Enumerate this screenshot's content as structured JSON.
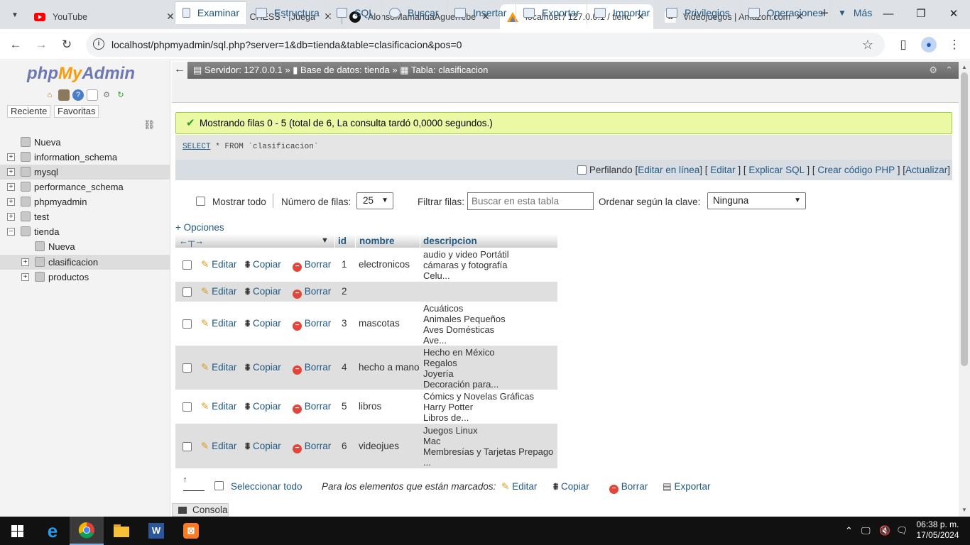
{
  "browser": {
    "tabs": [
      {
        "title": "YouTube",
        "icon": "youtube-icon"
      },
      {
        "title": "MASTER CHESS - ¡Juega Gr",
        "icon": "chess-icon"
      },
      {
        "title": "AlonsoMamahuaAguerrebe",
        "icon": "github-icon"
      },
      {
        "title": "localhost / 127.0.0.1 / tienda",
        "icon": "phpmyadmin-icon",
        "active": true
      },
      {
        "title": "Videojuegos | Amazon.com",
        "icon": "amazon-icon"
      }
    ],
    "url": "localhost/phpmyadmin/sql.php?server=1&db=tienda&table=clasificacion&pos=0"
  },
  "nav": {
    "logo_php": "php",
    "logo_my": "My",
    "logo_admin": "Admin",
    "tabs": [
      "Reciente",
      "Favoritas"
    ],
    "tree": [
      {
        "label": "Nueva",
        "level": 0,
        "expander": ""
      },
      {
        "label": "information_schema",
        "level": 0,
        "expander": "+"
      },
      {
        "label": "mysql",
        "level": 0,
        "expander": "+",
        "highlight": true
      },
      {
        "label": "performance_schema",
        "level": 0,
        "expander": "+"
      },
      {
        "label": "phpmyadmin",
        "level": 0,
        "expander": "+"
      },
      {
        "label": "test",
        "level": 0,
        "expander": "+"
      },
      {
        "label": "tienda",
        "level": 0,
        "expander": "−"
      },
      {
        "label": "Nueva",
        "level": 1,
        "expander": ""
      },
      {
        "label": "clasificacion",
        "level": 1,
        "expander": "+",
        "highlight": true
      },
      {
        "label": "productos",
        "level": 1,
        "expander": "+"
      }
    ]
  },
  "breadcrumb": {
    "server": "Servidor: 127.0.0.1",
    "database": "Base de datos: tienda",
    "table": "Tabla: clasificacion"
  },
  "main_tabs": [
    "Examinar",
    "Estructura",
    "SQL",
    "Buscar",
    "Insertar",
    "Exportar",
    "Importar",
    "Privilegios",
    "Operaciones",
    "Más"
  ],
  "success_message": "Mostrando filas 0 - 5 (total de 6, La consulta tardó 0,0000 segundos.)",
  "sql": {
    "select": "SELECT",
    "rest": " * FROM `clasificacion`"
  },
  "profiling": {
    "label": "Perfilando",
    "links": [
      "Editar en línea",
      "Editar",
      "Explicar SQL",
      "Crear código PHP",
      "Actualizar"
    ]
  },
  "filters": {
    "show_all": "Mostrar todo",
    "rows_label": "Número de filas:",
    "rows_value": "25",
    "filter_label": "Filtrar filas:",
    "filter_placeholder": "Buscar en esta tabla",
    "order_label": "Ordenar según la clave:",
    "order_value": "Ninguna"
  },
  "options_link": "+ Opciones",
  "table": {
    "columns": [
      "id",
      "nombre",
      "descripcion"
    ],
    "actions": {
      "edit": "Editar",
      "copy": "Copiar",
      "delete": "Borrar"
    },
    "rows": [
      {
        "id": "1",
        "nombre": "electronicos",
        "descripcion": "audio y video Portátil\ncámaras y fotografía\nCelu..."
      },
      {
        "id": "2",
        "nombre": "",
        "descripcion": ""
      },
      {
        "id": "3",
        "nombre": "mascotas",
        "descripcion": "Acuáticos\nAnimales Pequeños\nAves Domésticas\nAve..."
      },
      {
        "id": "4",
        "nombre": "hecho a mano",
        "descripcion": "Hecho en México\nRegalos\nJoyería\nDecoración para..."
      },
      {
        "id": "5",
        "nombre": "libros",
        "descripcion": "Cómics y Novelas Gráficas\nHarry Potter\nLibros de..."
      },
      {
        "id": "6",
        "nombre": "videojues",
        "descripcion": "Juegos Linux\nMac\nMembresías y Tarjetas Prepago\n..."
      }
    ]
  },
  "bulk": {
    "select_all": "Seleccionar todo",
    "marked_label": "Para los elementos que están marcados:",
    "edit": "Editar",
    "copy": "Copiar",
    "delete": "Borrar",
    "export": "Exportar"
  },
  "console_label": "Consola",
  "taskbar": {
    "time": "06:38 p. m.",
    "date": "17/05/2024"
  }
}
